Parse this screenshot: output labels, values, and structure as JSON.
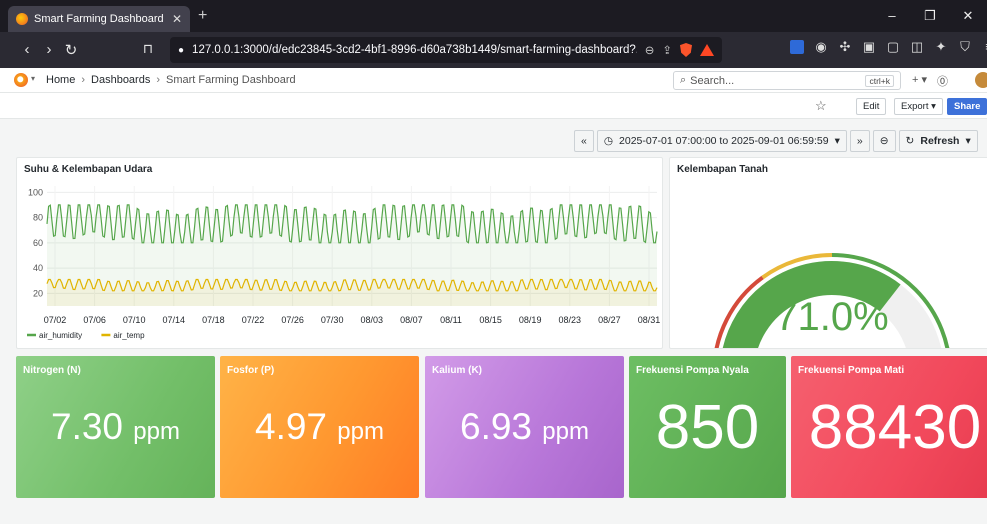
{
  "browser": {
    "tab_title": "Smart Farming Dashboard - Dash",
    "url": "127.0.0.1:3000/d/edc23845-3cd2-4bf1-8996-d60a738b1449/smart-farming-dashboard?..."
  },
  "grafana": {
    "breadcrumbs": [
      "Home",
      "Dashboards",
      "Smart Farming Dashboard"
    ],
    "search_placeholder": "Search...",
    "search_shortcut": "ctrl+k",
    "actions": {
      "edit": "Edit",
      "export": "Export",
      "share": "Share"
    },
    "time_range": "2025-07-01 07:00:00 to 2025-09-01 06:59:59",
    "refresh": "Refresh"
  },
  "panels": {
    "timeseries_title": "Suhu & Kelembapan Udara",
    "gauge_title": "Kelembapan Tanah",
    "gauge_value": "71.0%",
    "nitrogen": {
      "title": "Nitrogen (N)",
      "value": "7.30",
      "unit": "ppm",
      "color": "#73bf69"
    },
    "fosfor": {
      "title": "Fosfor (P)",
      "value": "4.97",
      "unit": "ppm",
      "color": "#ff9830"
    },
    "kalium": {
      "title": "Kalium (K)",
      "value": "6.93",
      "unit": "ppm",
      "color": "#b877d9"
    },
    "pompa_nyala": {
      "title": "Frekuensi Pompa Nyala",
      "value": "850",
      "color": "#56a64b"
    },
    "pompa_mati": {
      "title": "Frekuensi Pompa Mati",
      "value": "88430",
      "color": "#f2495c"
    }
  },
  "chart_data": [
    {
      "type": "line",
      "x_ticks": [
        "07/02",
        "07/06",
        "07/10",
        "07/14",
        "07/18",
        "07/22",
        "07/26",
        "07/30",
        "08/03",
        "08/07",
        "08/11",
        "08/15",
        "08/19",
        "08/23",
        "08/27",
        "08/31"
      ],
      "ylim": [
        10,
        105
      ],
      "y_ticks": [
        20,
        40,
        60,
        80,
        100
      ],
      "grid": true,
      "legend_position": "bottom-left",
      "series": [
        {
          "name": "air_humidity",
          "color": "#56a64b",
          "daily_min": 60,
          "daily_max": 90
        },
        {
          "name": "air_temp",
          "color": "#e0b400",
          "daily_min": 22,
          "daily_max": 31
        }
      ]
    },
    {
      "type": "gauge",
      "value": 71.0,
      "min": 0,
      "max": 100,
      "thresholds": [
        {
          "color": "#d44a3a",
          "from": 0,
          "to": 30
        },
        {
          "color": "#eab839",
          "from": 30,
          "to": 50
        },
        {
          "color": "#56a64b",
          "from": 50,
          "to": 100
        }
      ]
    }
  ]
}
